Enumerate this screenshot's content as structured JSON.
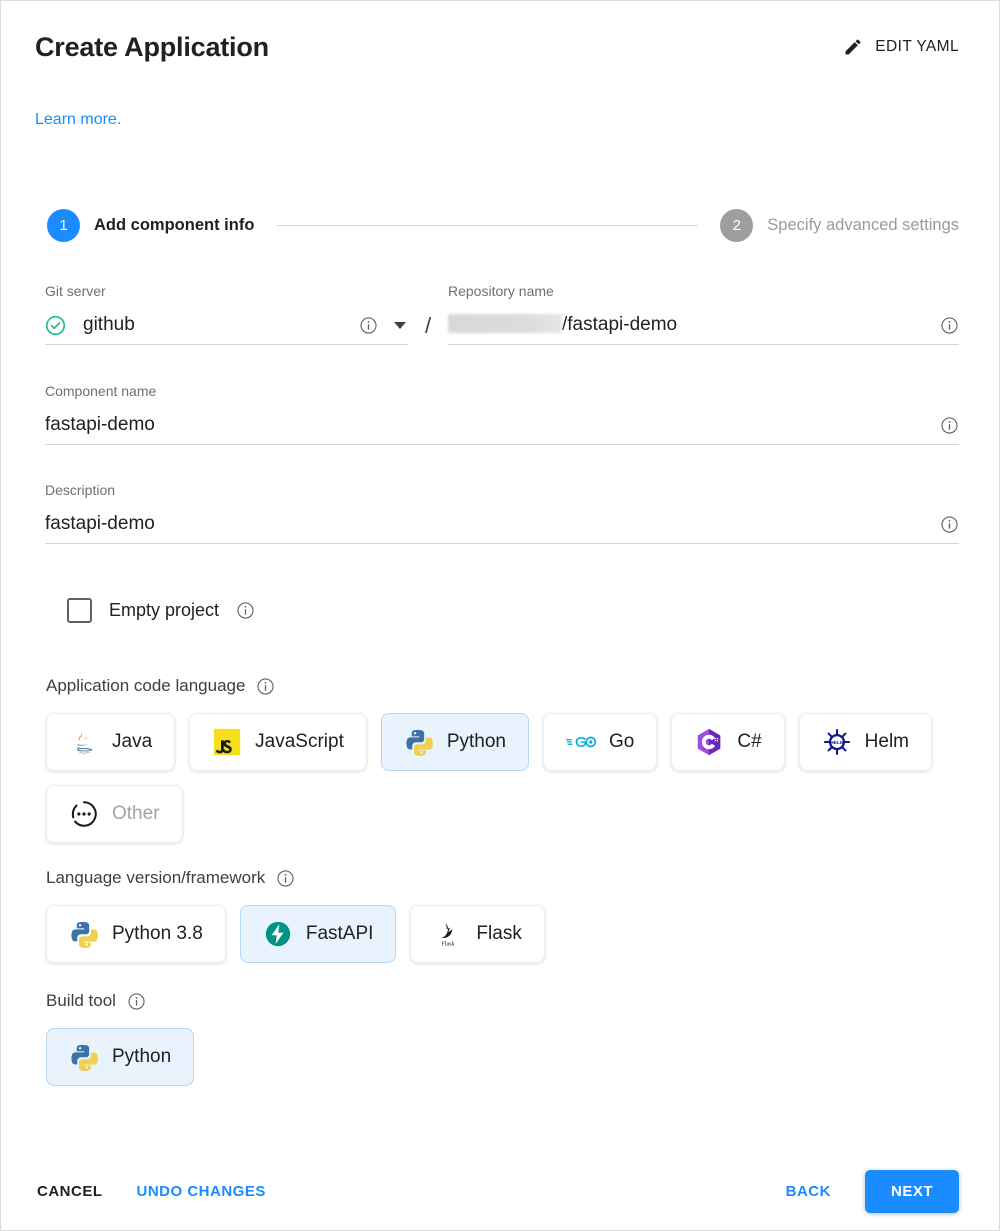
{
  "header": {
    "title": "Create Application",
    "edit_yaml_label": "EDIT YAML",
    "pencil_icon": "pencil-icon"
  },
  "learn_more": {
    "label": "Learn more."
  },
  "stepper": {
    "steps": [
      {
        "number": "1",
        "label": "Add component info",
        "state": "active"
      },
      {
        "number": "2",
        "label": "Specify advanced settings",
        "state": "inactive"
      }
    ]
  },
  "form": {
    "git_server": {
      "label": "Git server",
      "value": "github",
      "status_icon": "check-circle-icon",
      "info_icon": "info-icon",
      "dropdown_icon": "chevron-down-icon"
    },
    "separator": "/",
    "repository_name": {
      "label": "Repository name",
      "redacted_prefix": "",
      "value": "/fastapi-demo",
      "info_icon": "info-icon"
    },
    "component_name": {
      "label": "Component name",
      "value": "fastapi-demo",
      "info_icon": "info-icon"
    },
    "description": {
      "label": "Description",
      "value": "fastapi-demo",
      "info_icon": "info-icon"
    },
    "empty_project": {
      "label": "Empty project",
      "checked": false,
      "info_icon": "info-icon"
    }
  },
  "application_code_language": {
    "label": "Application code language",
    "info_icon": "info-icon",
    "options": [
      {
        "label": "Java",
        "icon": "java-icon",
        "selected": false,
        "disabled": false
      },
      {
        "label": "JavaScript",
        "icon": "javascript-icon",
        "selected": false,
        "disabled": false
      },
      {
        "label": "Python",
        "icon": "python-icon",
        "selected": true,
        "disabled": false
      },
      {
        "label": "Go",
        "icon": "go-icon",
        "selected": false,
        "disabled": false
      },
      {
        "label": "C#",
        "icon": "csharp-icon",
        "selected": false,
        "disabled": false
      },
      {
        "label": "Helm",
        "icon": "helm-icon",
        "selected": false,
        "disabled": false
      },
      {
        "label": "Other",
        "icon": "other-icon",
        "selected": false,
        "disabled": true
      }
    ]
  },
  "language_version_framework": {
    "label": "Language version/framework",
    "info_icon": "info-icon",
    "options": [
      {
        "label": "Python 3.8",
        "icon": "python-icon",
        "selected": false
      },
      {
        "label": "FastAPI",
        "icon": "fastapi-icon",
        "selected": true
      },
      {
        "label": "Flask",
        "icon": "flask-icon",
        "selected": false
      }
    ]
  },
  "build_tool": {
    "label": "Build tool",
    "info_icon": "info-icon",
    "options": [
      {
        "label": "Python",
        "icon": "python-icon",
        "selected": true
      }
    ]
  },
  "footer": {
    "cancel_label": "CANCEL",
    "undo_label": "UNDO CHANGES",
    "back_label": "BACK",
    "next_label": "NEXT"
  },
  "colors": {
    "accent_blue": "#1a8cff",
    "selected_chip_bg": "#e9f3fe",
    "selected_chip_border": "#b6d8f7",
    "step_inactive_gray": "#9e9e9e",
    "success_green": "#25c08a",
    "fastapi_teal": "#009485"
  }
}
